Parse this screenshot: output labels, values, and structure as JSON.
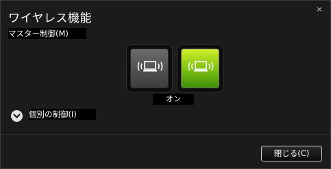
{
  "window": {
    "title": "ワイヤレス機能",
    "close_glyph": "×"
  },
  "master": {
    "label": "マスター制御(M)"
  },
  "toggle": {
    "state_label": "オン",
    "off_icon": "wireless-laptop-icon",
    "on_icon": "wireless-laptop-icon",
    "on_color": "#8fcc14",
    "off_color": "#5a5a5a"
  },
  "individual": {
    "label": "個別の制御(I)",
    "expander_icon": "chevron-down-icon"
  },
  "footer": {
    "close_label": "閉じる(C)"
  }
}
